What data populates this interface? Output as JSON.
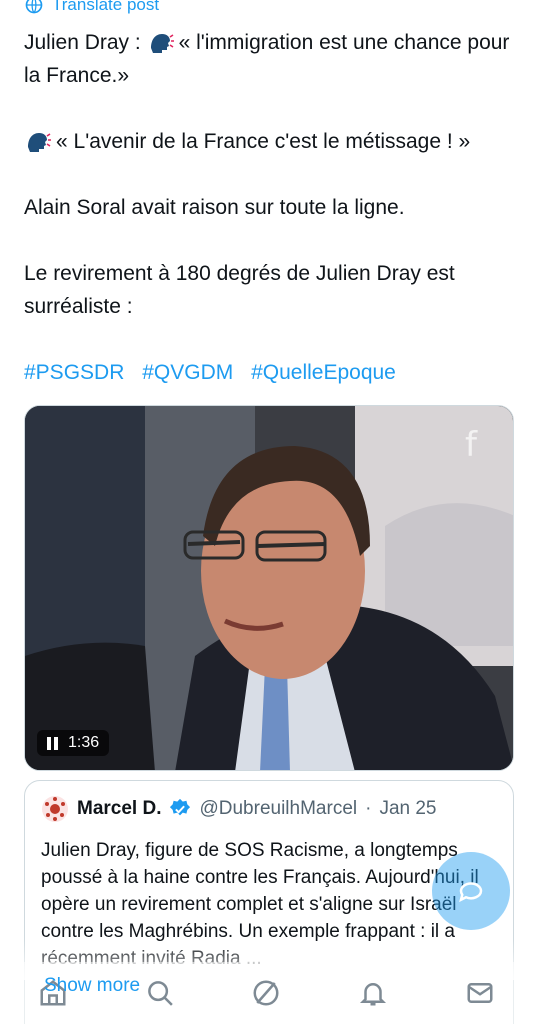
{
  "translate": {
    "label": "Translate post",
    "icon": "globe-icon"
  },
  "tweet": {
    "line1_pre": "Julien Dray :",
    "line1_post": "« l'immigration est une chance pour la France.»",
    "line2": "« L'avenir de la France c'est le métissage ! »",
    "line3": "Alain Soral avait raison sur toute la ligne.",
    "line4": "Le revirement à 180 degrés de Julien Dray est surréaliste :",
    "hashtags": [
      "#PSGSDR",
      "#QVGDM",
      "#QuelleEpoque"
    ],
    "emoji": "speaking-head-emoji"
  },
  "video": {
    "duration": "1:36",
    "channel_logo": "france-tv-logo"
  },
  "quoted": {
    "name": "Marcel D.",
    "handle": "@DubreuilhMarcel",
    "separator": "·",
    "date": "Jan 25",
    "text": "Julien Dray, figure de SOS Racisme, a longtemps poussé à la haine contre les Français. Aujourd'hui, il opère un revirement complet et s'aligne sur Israël contre les Maghrébins. Un exemple frappant : il a récemment invité Radia ...",
    "show_more": "Show more"
  },
  "colors": {
    "accent": "#1d9bf0",
    "text": "#0f1419",
    "muted": "#536471",
    "border": "#cfd9de"
  },
  "nav": [
    "home-icon",
    "search-icon",
    "grok-icon",
    "notifications-icon",
    "messages-icon"
  ]
}
